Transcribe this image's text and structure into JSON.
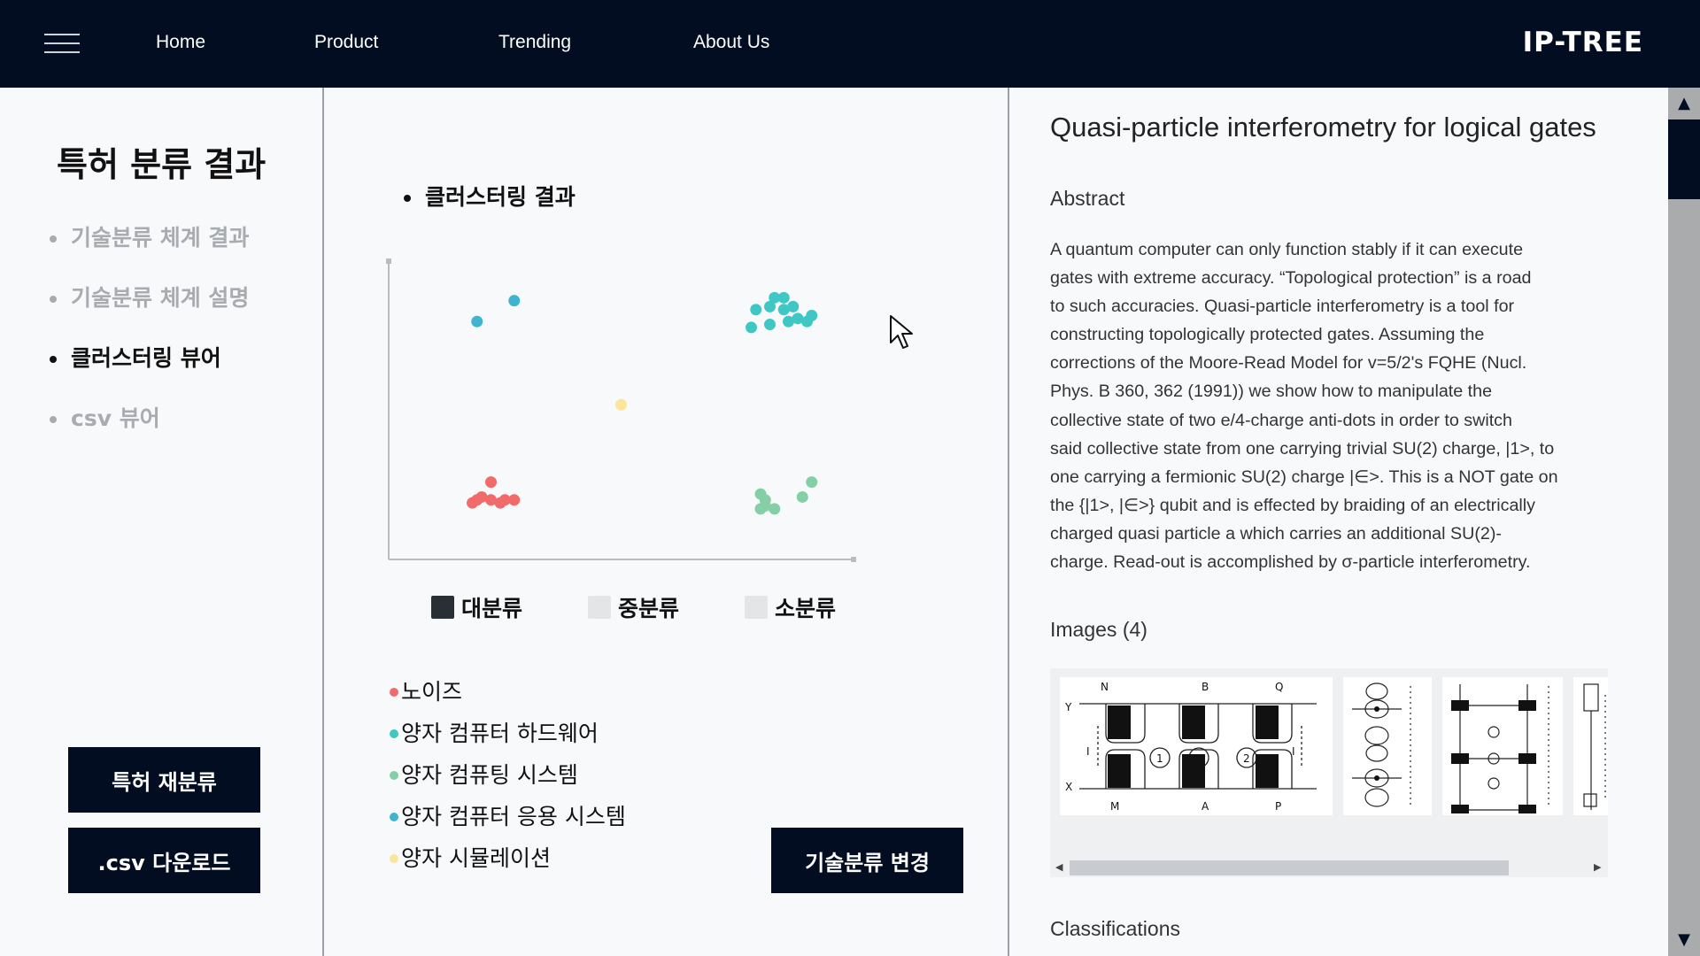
{
  "nav": {
    "items": [
      "Home",
      "Product",
      "Trending",
      "About Us"
    ],
    "brand": "IP-TREE"
  },
  "sidebar": {
    "title": "특허 분류 결과",
    "items": [
      {
        "label": "기술분류 체계 결과",
        "active": false
      },
      {
        "label": "기술분류 체계 설명",
        "active": false
      },
      {
        "label": "클러스터링 뷰어",
        "active": true
      },
      {
        "label": "csv 뷰어",
        "active": false
      }
    ],
    "reclassify_button": "특허 재분류",
    "csv_download_button": ".csv 다운로드"
  },
  "middle": {
    "section_heading": "클러스터링 결과",
    "legend": [
      {
        "label": "대분류",
        "color": "#2a2e35"
      },
      {
        "label": "중분류",
        "color": "#e4e5e7"
      },
      {
        "label": "소분류",
        "color": "#e4e5e7"
      }
    ],
    "cluster_labels": [
      {
        "label": "노이즈",
        "color": "#f26b6b"
      },
      {
        "label": "양자 컴퓨터 하드웨어",
        "color": "#3ec7c4"
      },
      {
        "label": "양자 컴퓨팅 시스템",
        "color": "#85cfa6"
      },
      {
        "label": "양자 컴퓨터 응용 시스템",
        "color": "#3fb4d0"
      },
      {
        "label": "양자 시뮬레이션",
        "color": "#fbe59a"
      }
    ],
    "change_button": "기술분류 변경"
  },
  "chart_data": {
    "type": "scatter",
    "title": "",
    "xlabel": "",
    "ylabel": "",
    "grid": false,
    "xlim": [
      0,
      100
    ],
    "ylim": [
      0,
      100
    ],
    "series": [
      {
        "color": "#3fb4d0",
        "points": [
          [
            19,
            80
          ],
          [
            27,
            87
          ]
        ]
      },
      {
        "color": "#3ec7c4",
        "points": [
          [
            83,
            88
          ],
          [
            85,
            88
          ],
          [
            82,
            85
          ],
          [
            85,
            84
          ],
          [
            87,
            85
          ],
          [
            79,
            84
          ],
          [
            88,
            81
          ],
          [
            91,
            82
          ],
          [
            86,
            80
          ],
          [
            82,
            79
          ],
          [
            78,
            78
          ],
          [
            90,
            80
          ]
        ]
      },
      {
        "color": "#fbe59a",
        "points": [
          [
            50,
            52
          ]
        ]
      },
      {
        "color": "#f26b6b",
        "points": [
          [
            22,
            26
          ],
          [
            19,
            20
          ],
          [
            20,
            21
          ],
          [
            22,
            20
          ],
          [
            24,
            19
          ],
          [
            25,
            20
          ],
          [
            27,
            20
          ],
          [
            18,
            19
          ]
        ]
      },
      {
        "color": "#85cfa6",
        "points": [
          [
            91,
            26
          ],
          [
            89,
            21
          ],
          [
            80,
            22
          ],
          [
            81,
            20
          ],
          [
            81,
            18
          ],
          [
            80,
            17
          ],
          [
            83,
            17
          ]
        ]
      }
    ]
  },
  "paper": {
    "title": "Quasi-particle interferometry for logical gates",
    "abstract_heading": "Abstract",
    "abstract_lines": [
      "A quantum computer can only function stably if it can execute",
      "gates with extreme accuracy. “Topological protection” is a road",
      "to such accuracies. Quasi-particle interferometry is a tool for",
      "constructing topologically protected gates. Assuming the",
      "corrections of the Moore-Read Model for v=5/2's FQHE (Nucl.",
      "Phys. B 360, 362 (1991)) we show how to manipulate the",
      "collective state of two e/4-charge anti-dots in order to switch",
      "said collective state from one carrying trivial SU(2) charge, |1>, to",
      "one carrying a fermionic SU(2) charge |∈>. This is a NOT gate on",
      "the {|1>, |∈>} qubit and is effected by braiding of an electrically",
      "charged quasi particle a which carries an additional SU(2)-",
      "charge. Read-out is accomplished by σ-particle interferometry."
    ],
    "images_heading": "Images (4)",
    "classifications_heading": "Classifications",
    "figure1_labels": [
      "N",
      "B",
      "Q",
      "Y",
      "X",
      "M",
      "A",
      "P",
      "1",
      "3",
      "2",
      "I",
      "I"
    ]
  }
}
